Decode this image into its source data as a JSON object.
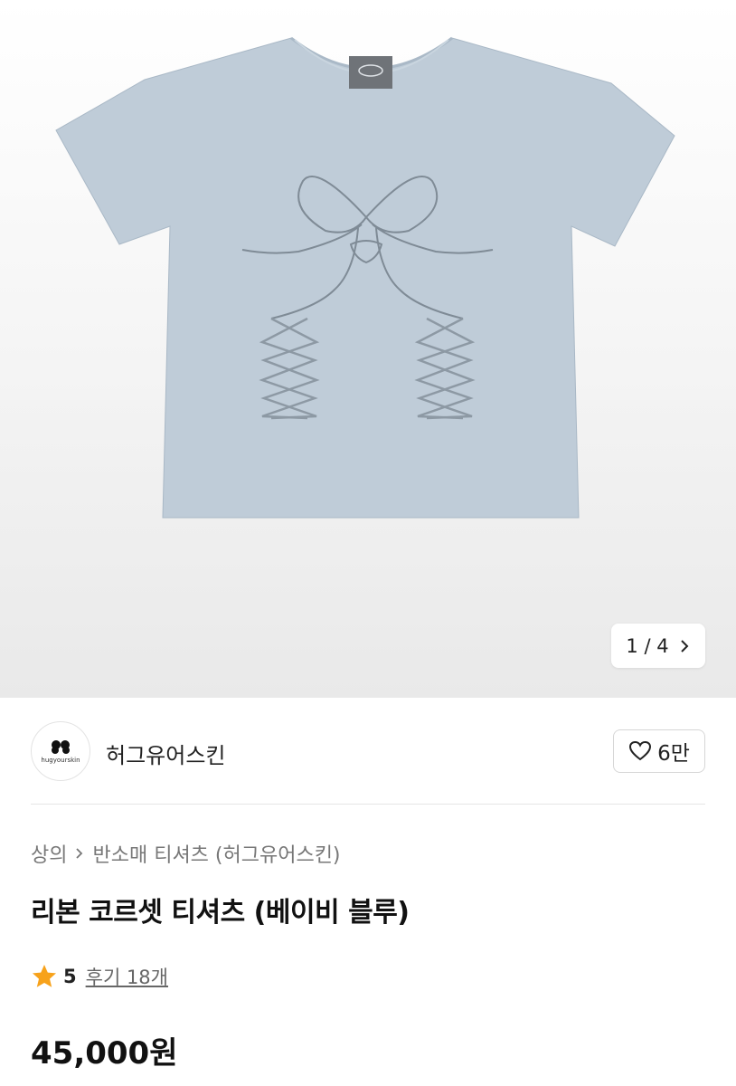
{
  "gallery": {
    "counter": "1 / 4",
    "next_icon": "chevron-right-icon",
    "product_photo": "light-blue-cropped-t-shirt-with-ribbon-corset-print"
  },
  "brand": {
    "name": "허그유어스킨",
    "avatar_text": "hugyourskin",
    "like_icon": "heart-outline-icon",
    "like_count": "6만"
  },
  "breadcrumb": {
    "category": "상의",
    "separator_icon": "chevron-right-icon",
    "subcategory": "반소매 티셔츠 (허그유어스킨)"
  },
  "product": {
    "title": "리본 코르셋 티셔츠 (베이비 블루)",
    "rating": "5",
    "reviews": "후기 18개",
    "price": "45,000원"
  },
  "colors": {
    "shirt": "#bfccd8",
    "star": "#f7a21b",
    "text": "#111111",
    "muted": "#777777"
  }
}
